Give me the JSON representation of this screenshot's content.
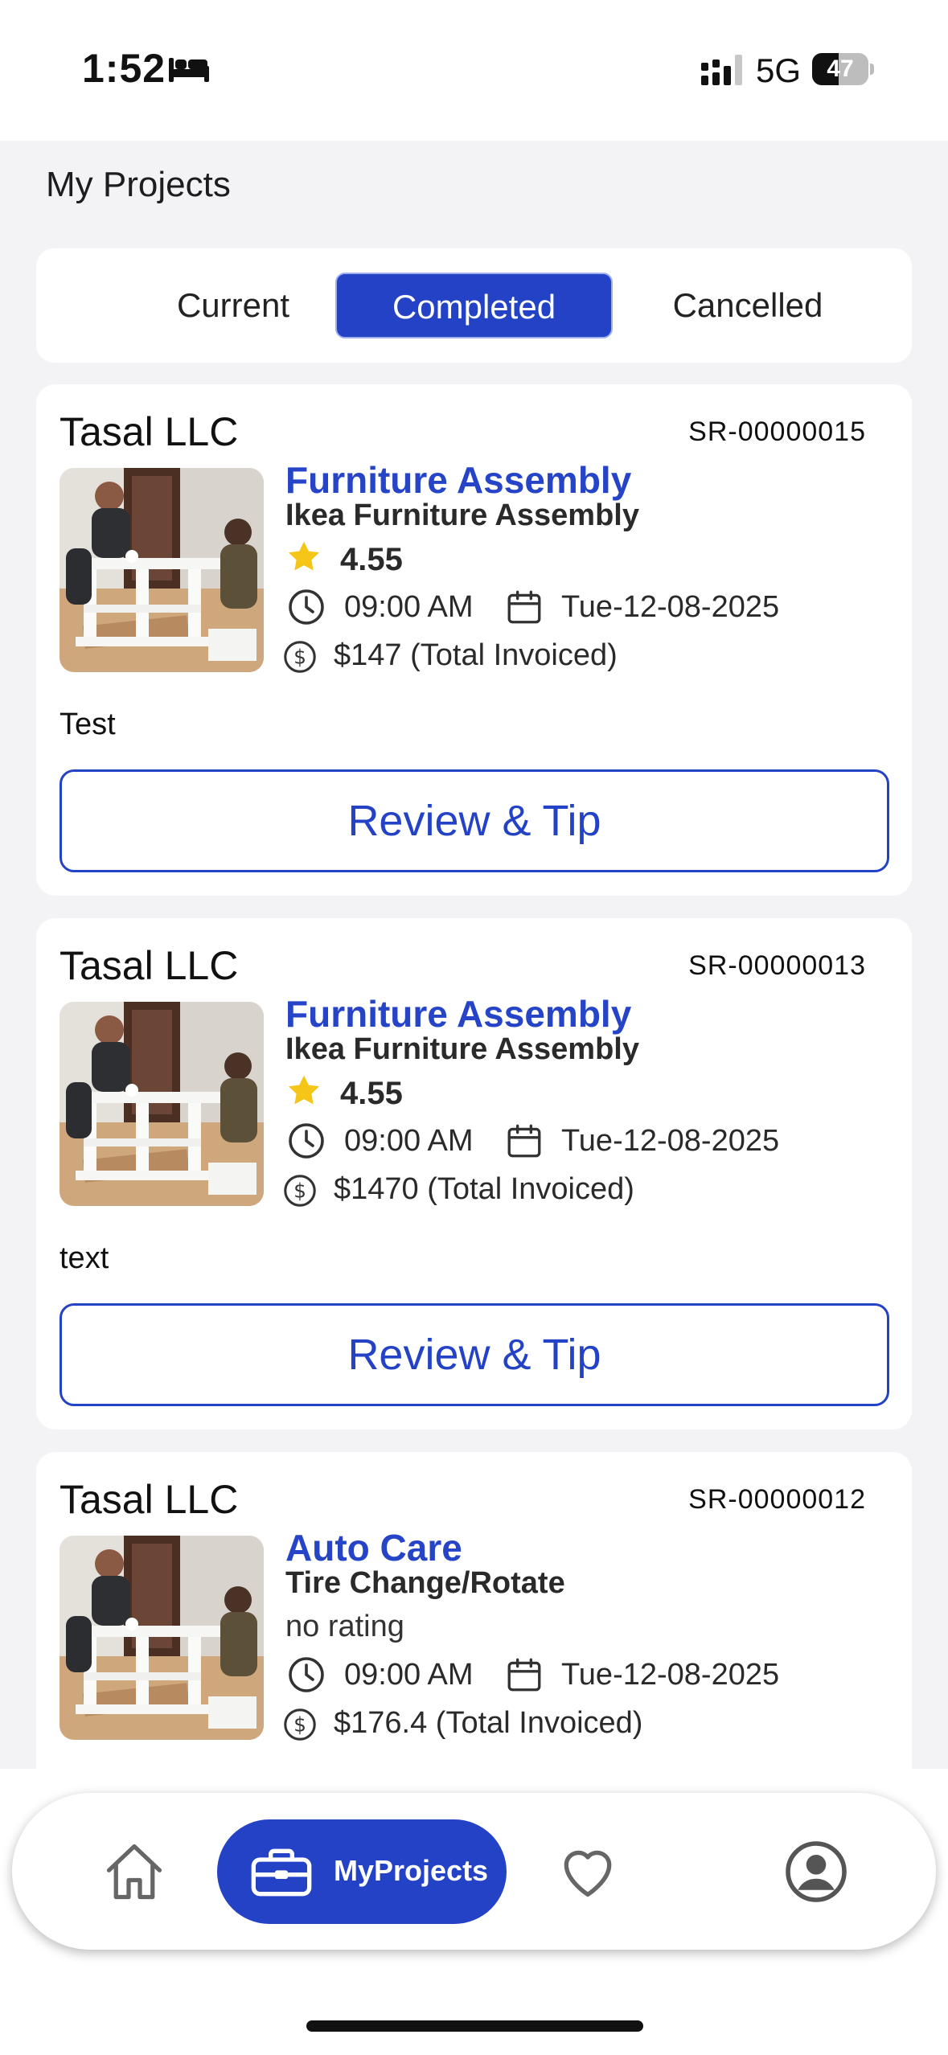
{
  "status_bar": {
    "time": "1:52",
    "network": "5G",
    "battery": "47",
    "battery_level": 0.47
  },
  "page": {
    "title": "My Projects"
  },
  "tabs": [
    {
      "label": "Current",
      "active": false
    },
    {
      "label": "Completed",
      "active": true
    },
    {
      "label": "Cancelled",
      "active": false
    }
  ],
  "projects": [
    {
      "company": "Tasal LLC",
      "sr": "SR-00000015",
      "category": "Furniture Assembly",
      "service": "Ikea Furniture Assembly",
      "rating": "4.55",
      "time": "09:00 AM",
      "date": "Tue-12-08-2025",
      "invoice": "$147 (Total Invoiced)",
      "note": "Test",
      "button": "Review & Tip"
    },
    {
      "company": "Tasal LLC",
      "sr": "SR-00000013",
      "category": "Furniture Assembly",
      "service": "Ikea Furniture Assembly",
      "rating": "4.55",
      "time": "09:00 AM",
      "date": "Tue-12-08-2025",
      "invoice": "$1470 (Total Invoiced)",
      "note": "text",
      "button": "Review & Tip"
    },
    {
      "company": "Tasal LLC",
      "sr": "SR-00000012",
      "category": "Auto Care",
      "service": "Tire Change/Rotate",
      "rating_text": "no rating",
      "time": "09:00 AM",
      "date": "Tue-12-08-2025",
      "invoice": "$176.4 (Total Invoiced)"
    }
  ],
  "nav": {
    "projects_label": "MyProjects"
  },
  "colors": {
    "accent": "#2342c6",
    "star": "#f5c518",
    "background": "#f3f3f5"
  },
  "icons": [
    "bed-icon",
    "signal-icon",
    "star-icon",
    "clock-icon",
    "calendar-icon",
    "dollar-icon",
    "home-icon",
    "briefcase-icon",
    "heart-icon",
    "profile-icon"
  ]
}
